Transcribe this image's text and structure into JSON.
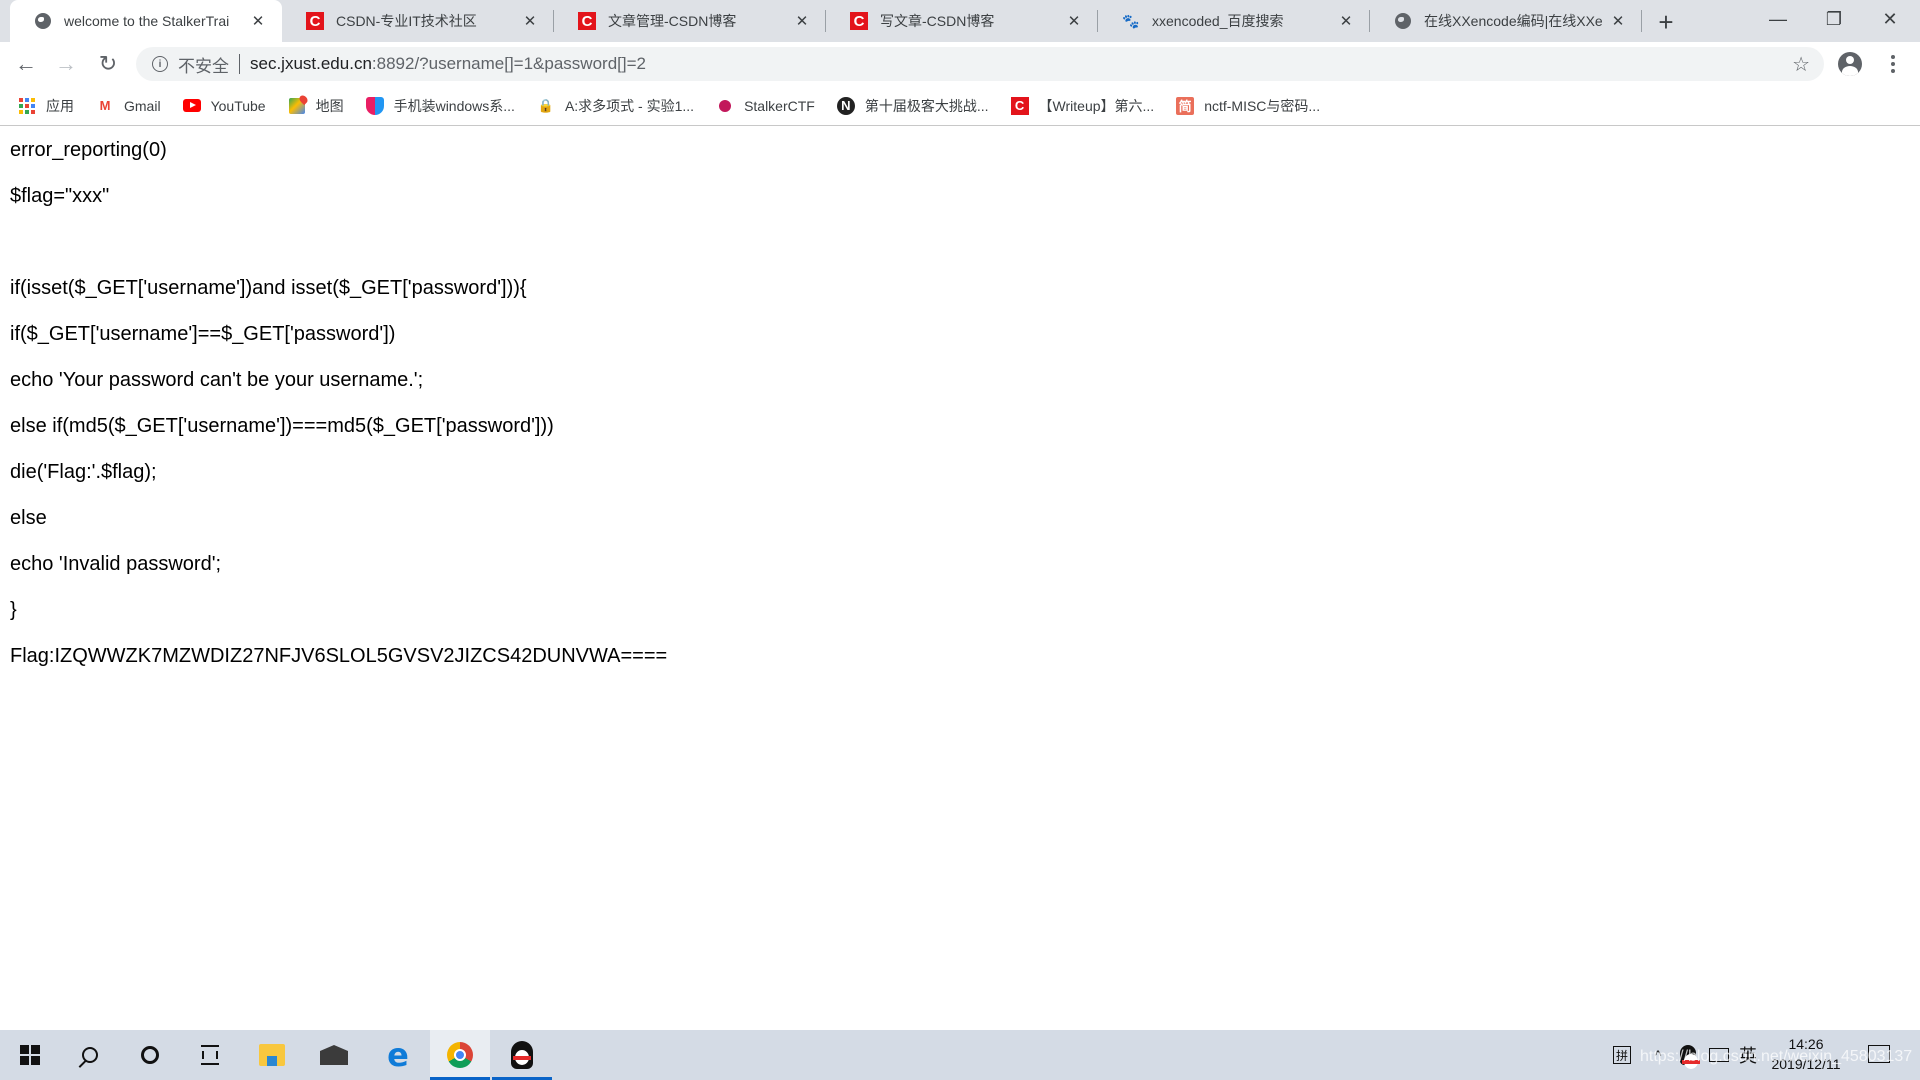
{
  "browser": {
    "tabs": [
      {
        "title": "welcome to the StalkerTrai",
        "icon": "globe-icon",
        "active": true
      },
      {
        "title": "CSDN-专业IT技术社区",
        "icon": "csdn-icon",
        "active": false
      },
      {
        "title": "文章管理-CSDN博客",
        "icon": "csdn-icon",
        "active": false
      },
      {
        "title": "写文章-CSDN博客",
        "icon": "csdn-icon",
        "active": false
      },
      {
        "title": "xxencoded_百度搜索",
        "icon": "baidu-icon",
        "active": false
      },
      {
        "title": "在线XXencode编码|在线XXe",
        "icon": "globe-icon",
        "active": false
      }
    ],
    "new_tab_label": "+",
    "window_controls": {
      "minimize": "—",
      "maximize": "❐",
      "close": "✕"
    },
    "close_tab_glyph": "✕",
    "toolbar": {
      "back": "←",
      "forward": "→",
      "reload": "↻",
      "security_label": "不安全",
      "url_host": "sec.jxust.edu.cn",
      "url_path": ":8892/?username[]=1&password[]=2",
      "bookmark_star": "☆"
    },
    "bookmarks": [
      {
        "label": "应用",
        "icon": "apps-grid-icon"
      },
      {
        "label": "Gmail",
        "icon": "gmail-icon"
      },
      {
        "label": "YouTube",
        "icon": "youtube-icon"
      },
      {
        "label": "地图",
        "icon": "maps-icon"
      },
      {
        "label": "手机装windows系...",
        "icon": "heart-icon"
      },
      {
        "label": "A:求多项式 - 实验1...",
        "icon": "lock-icon"
      },
      {
        "label": "StalkerCTF",
        "icon": "stalker-icon"
      },
      {
        "label": "第十届极客大挑战...",
        "icon": "n-icon"
      },
      {
        "label": "【Writeup】第六...",
        "icon": "csdn-icon"
      },
      {
        "label": "nctf-MISC与密码...",
        "icon": "jianshu-icon"
      }
    ]
  },
  "page": {
    "lines": [
      "error_reporting(0)",
      "$flag=\"xxx\"",
      "",
      "if(isset($_GET['username'])and isset($_GET['password'])){",
      "if($_GET['username']==$_GET['password'])",
      "echo 'Your password can't be your username.';",
      "else if(md5($_GET['username'])===md5($_GET['password']))",
      "die('Flag:'.$flag);",
      "else",
      "echo 'Invalid password';",
      "}",
      "Flag:IZQWWZK7MZWDIZ27NFJV6SLOL5GVSV2JIZCS42DUNVWA===="
    ]
  },
  "taskbar": {
    "items": [
      "start",
      "search",
      "cortana",
      "task-view",
      "file-explorer",
      "mail",
      "edge",
      "chrome",
      "qq"
    ],
    "active_items": [
      "chrome",
      "qq"
    ],
    "tray": {
      "ime_mode": "拼",
      "chevron": "^",
      "language": "英",
      "time": "14:26",
      "date": "2019/12/11"
    },
    "watermark": "https://blog.csdn.net/weixin_45803137"
  },
  "colors": {
    "tabstrip_bg": "#dee1e6",
    "omnibox_bg": "#f1f3f4",
    "taskbar_bg": "#d4dbe5",
    "taskbar_accent": "#0a64c8",
    "csdn_red": "#e3141b"
  }
}
